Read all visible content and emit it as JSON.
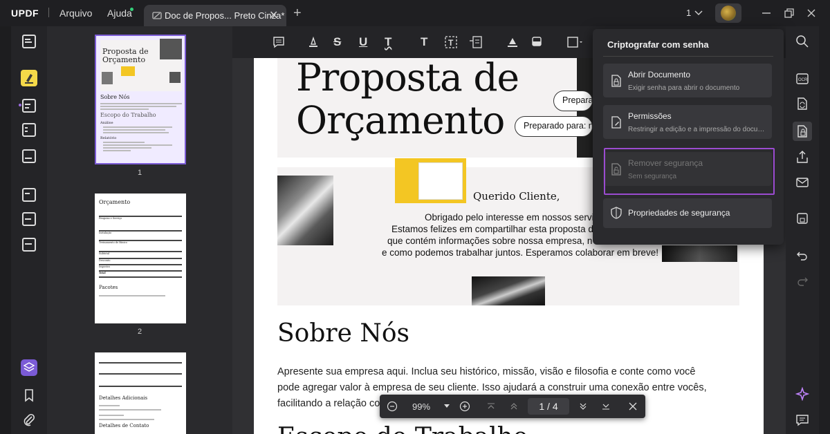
{
  "app": {
    "logo": "UPDF",
    "menu": [
      "Arquivo",
      "Ajuda"
    ],
    "tab_title": "Doc de Propos... Preto Cinza*",
    "page_indicator": "1"
  },
  "thumbnails": {
    "numbers": [
      "1",
      "2"
    ],
    "t1": {
      "title1": "Proposta de",
      "title2": "Orçamento",
      "h1": "Sobre Nós",
      "h2": "Escopo do Trabalho",
      "s1": "Análise",
      "s2": "Relatório"
    },
    "t2": {
      "title": "Orçamento",
      "h2": "Pacotes",
      "rows": [
        "Pesquisa e Serviço",
        "Instalação",
        "Treinamento de Básico",
        "Análise",
        "Relatório",
        "Subtotal",
        "Desconto",
        "Impostos",
        "Total"
      ]
    },
    "t3": {
      "h1": "Detalhes Adicionais",
      "h2": "Detalhes de Contato"
    }
  },
  "document": {
    "title_line1": "Proposta de",
    "title_line2": "Orçamento",
    "pill1": "Preparado por: nome",
    "pill2": "Preparado para: nome",
    "greeting": "Querido Cliente,",
    "intro": [
      "Obrigado pelo interesse em nossos serviços.",
      "Estamos felizes em compartilhar esta proposta de orçamento",
      "que contém informações sobre nossa empresa, nosso processo",
      "e como podemos trabalhar juntos. Esperamos colaborar em breve!"
    ],
    "heading_sobre": "Sobre Nós",
    "para": [
      "Apresente sua empresa aqui. Inclua seu histórico, missão, visão e filosofia e conte como você",
      "pode agregar valor à empresa de seu cliente. Isso ajudará a construir uma conexão entre vocês,",
      "facilitando a relação com"
    ],
    "heading_escopo": "Escopo do Trabalho"
  },
  "zoombar": {
    "zoom": "99%",
    "page": "1 / 4"
  },
  "dropdown": {
    "title": "Criptografar com senha",
    "items": [
      {
        "title": "Abrir Documento",
        "subtitle": "Exigir senha para abrir o documento"
      },
      {
        "title": "Permissões",
        "subtitle": "Restringir a edição e a impressão do documento"
      },
      {
        "title": "Remover segurança",
        "subtitle": "Sem segurança"
      },
      {
        "title": "Propriedades de segurança",
        "subtitle": ""
      }
    ]
  },
  "colors": {
    "accent": "#7b5bd6",
    "highlight_border": "#9b4bd1",
    "active_tool": "#f5d949"
  }
}
